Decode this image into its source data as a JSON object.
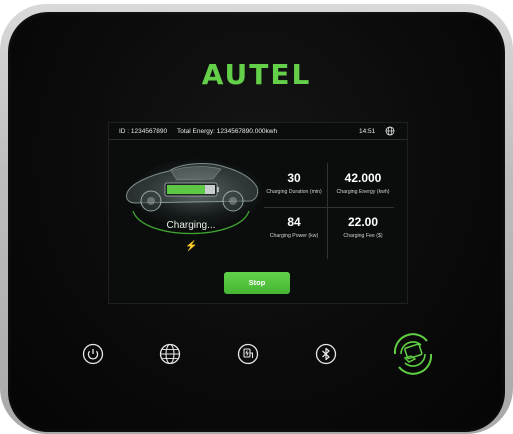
{
  "brand": {
    "logo_text": "AUTEL",
    "accent_color": "#64d04a"
  },
  "status_bar": {
    "id_text": "ID : 1234567890",
    "total_energy_text": "Total Energy: 1234567890.000kwh",
    "time": "14:51",
    "language_icon": "globe-icon"
  },
  "car_panel": {
    "status_label": "Charging...",
    "status_icon": "lightning-icon"
  },
  "stats": [
    {
      "value": "30",
      "label": "Charging Duration (min)"
    },
    {
      "value": "42.000",
      "label": "Charging Energy (kwh)"
    },
    {
      "value": "84",
      "label": "Charging Power (kw)"
    },
    {
      "value": "22.00",
      "label": "Charging Fee ($)"
    }
  ],
  "stop_button": {
    "label": "Stop"
  },
  "hardware_controls": [
    {
      "icon": "power-icon"
    },
    {
      "icon": "network-icon"
    },
    {
      "icon": "charging-plug-icon"
    },
    {
      "icon": "bluetooth-icon"
    },
    {
      "icon": "rfid-card-icon"
    }
  ]
}
